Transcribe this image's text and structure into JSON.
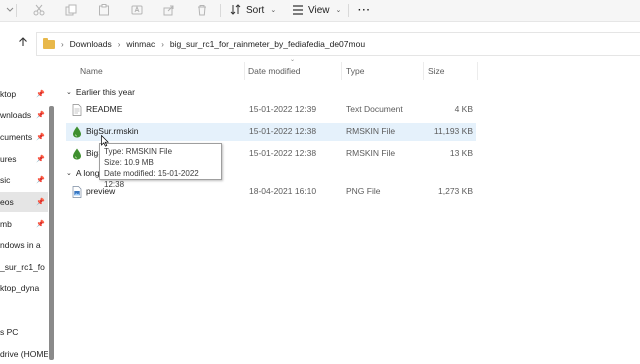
{
  "toolbar": {
    "sort_label": "Sort",
    "view_label": "View",
    "more_label": "···"
  },
  "address": {
    "crumbs": [
      "Downloads",
      "winmac",
      "big_sur_rc1_for_rainmeter_by_fediafedia_de07mou"
    ]
  },
  "sidebar": {
    "items": [
      {
        "label": "ktop",
        "pinned": true
      },
      {
        "label": "wnloads",
        "pinned": true
      },
      {
        "label": "cuments",
        "pinned": true
      },
      {
        "label": "ures",
        "pinned": true
      },
      {
        "label": "sic",
        "pinned": true
      },
      {
        "label": "eos",
        "pinned": true
      },
      {
        "label": "mb",
        "pinned": true
      },
      {
        "label": "ndows in a",
        "pinned": false
      },
      {
        "label": "_sur_rc1_fo",
        "pinned": false
      },
      {
        "label": "ktop_dyna",
        "pinned": false
      },
      {
        "label": "s PC",
        "pinned": false
      },
      {
        "label": "drive (HOME",
        "pinned": false
      }
    ]
  },
  "columns": {
    "name": "Name",
    "date_modified": "Date modified",
    "type": "Type",
    "size": "Size"
  },
  "groups": {
    "earlier_this_year": "Earlier this year",
    "a_long_time_ago": "A long t"
  },
  "files": [
    {
      "name": "README",
      "date": "15-01-2022 12:39",
      "type": "Text Document",
      "size": "4 KB",
      "icon": "text-file-icon"
    },
    {
      "name": "BigSur.rmskin",
      "date": "15-01-2022 12:38",
      "type": "RMSKIN File",
      "size": "11,193 KB",
      "icon": "rmskin-drop-icon"
    },
    {
      "name": "BigS",
      "date": "15-01-2022 12:38",
      "type": "RMSKIN File",
      "size": "13 KB",
      "icon": "rmskin-drop-icon"
    },
    {
      "name": "preview",
      "date": "18-04-2021 16:10",
      "type": "PNG File",
      "size": "1,273 KB",
      "icon": "png-file-icon"
    }
  ],
  "tooltip": {
    "type_line": "Type: RMSKIN File",
    "size_line": "Size: 10.9 MB",
    "date_line": "Date modified: 15-01-2022 12:38"
  },
  "colors": {
    "hover_row": "#e5f1fb",
    "selected_sidebar": "#e5e5e5",
    "folder": "#e8b84a",
    "rmskin_green": "#3f8f2f"
  }
}
